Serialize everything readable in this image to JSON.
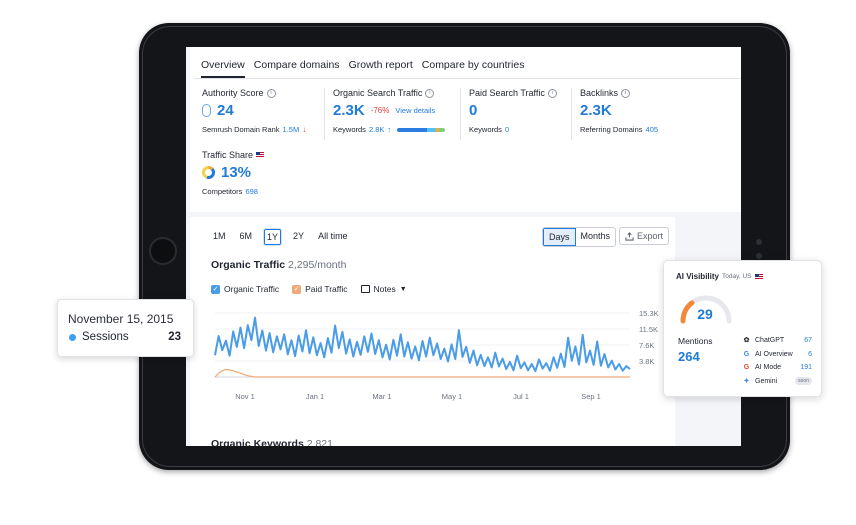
{
  "tabs": [
    "Overview",
    "Compare domains",
    "Growth report",
    "Compare by countries"
  ],
  "metrics": {
    "authority": {
      "label": "Authority Score",
      "value": "24",
      "sub_label": "Semrush Domain Rank",
      "sub_value": "1.5M",
      "sub_arrow": "↓"
    },
    "organic": {
      "label": "Organic Search Traffic",
      "value": "2.3K",
      "change": "-76%",
      "link": "View details",
      "sub_label": "Keywords",
      "sub_value": "2.8K",
      "sub_arrow": "↑"
    },
    "paid": {
      "label": "Paid Search Traffic",
      "value": "0",
      "sub_label": "Keywords",
      "sub_value": "0"
    },
    "backlinks": {
      "label": "Backlinks",
      "value": "2.3K",
      "sub_label": "Referring Domains",
      "sub_value": "405"
    },
    "traffic_share": {
      "label": "Traffic Share",
      "value": "13%",
      "sub_label": "Competitors",
      "sub_value": "698"
    }
  },
  "ranges": [
    "1M",
    "6M",
    "1Y",
    "2Y",
    "All time"
  ],
  "active_range": "1Y",
  "toggle": {
    "days": "Days",
    "months": "Months",
    "active": "Days"
  },
  "export_label": "Export",
  "chart_title": "Organic Traffic",
  "chart_subtitle": "2,295/month",
  "legend": {
    "organic": "Organic Traffic",
    "paid": "Paid Traffic",
    "notes": "Notes"
  },
  "keywords_title": "Organic Keywords",
  "keywords_value": "2,821",
  "colors": {
    "accent": "#1f7bd8",
    "organic": "#4a9ce8",
    "paid": "#f0a979",
    "negative": "#e23d3d"
  },
  "chart_data": {
    "type": "line",
    "x": [
      "Nov 1",
      "Jan 1",
      "Mar 1",
      "May 1",
      "Jul 1",
      "Sep 1"
    ],
    "ylim": [
      0,
      15300
    ],
    "yticks": [
      "15.3K",
      "11.5K",
      "7.6K",
      "3.8K",
      "0"
    ],
    "series": [
      {
        "name": "Organic Traffic",
        "values": [
          5200,
          9800,
          6400,
          8700,
          5100,
          10900,
          7200,
          11800,
          6900,
          12400,
          8800,
          14200,
          7400,
          11100,
          6300,
          10500,
          5900,
          9700,
          6600,
          10200,
          5400,
          8800,
          5000,
          9900,
          6100,
          11200,
          5700,
          9500,
          5200,
          8100,
          4700,
          9300,
          5800,
          12300,
          6900,
          10800,
          5600,
          9000,
          4900,
          8400,
          5300,
          9700,
          6000,
          10400,
          5500,
          8800,
          4700,
          7700,
          4200,
          8900,
          5100,
          10200,
          4900,
          8300,
          4400,
          7300,
          4000,
          8600,
          4900,
          9400,
          5200,
          8000,
          4300,
          6800,
          3700,
          7800,
          4300,
          11200,
          4800,
          7200,
          3400,
          6300,
          2800,
          5300,
          2600,
          4700,
          2300,
          5800,
          2500,
          4400,
          1900,
          3600,
          1600,
          5100,
          2100,
          3500,
          1600,
          3100,
          1400,
          4200,
          2000,
          3300,
          1500,
          4700,
          2200,
          5600,
          2400,
          9400,
          3900,
          7300,
          3000,
          10100,
          3500,
          6300,
          2900,
          8500,
          2700,
          5500,
          2300,
          3900,
          1800,
          3100,
          1500,
          2600,
          1900
        ]
      },
      {
        "name": "Paid Traffic",
        "values": [
          0,
          900,
          1500,
          1800,
          1700,
          1500,
          1200,
          900,
          600,
          300,
          150,
          0,
          0,
          0,
          0,
          0,
          0,
          0,
          0,
          0,
          0,
          0,
          0,
          0,
          0,
          0,
          0,
          0,
          0,
          0,
          0,
          0,
          0,
          0,
          0,
          0,
          0,
          0,
          0,
          0,
          0,
          0,
          0,
          0,
          0,
          0,
          0,
          0,
          0,
          0,
          0,
          0,
          0,
          0,
          0,
          0,
          0,
          0,
          0,
          0,
          0,
          0,
          0,
          0,
          0,
          0,
          0,
          0,
          0,
          0,
          0,
          0,
          0,
          0,
          0,
          0,
          0,
          0,
          0,
          0,
          0,
          0,
          0,
          0,
          0,
          0,
          0,
          0,
          0,
          0,
          0,
          0,
          0,
          0,
          0,
          0,
          0,
          0,
          0,
          0,
          0,
          0,
          0,
          0,
          0,
          0,
          0,
          0,
          0,
          0,
          0,
          0,
          0,
          0,
          0
        ]
      }
    ]
  },
  "tooltip": {
    "date": "November 15, 2015",
    "label": "Sessions",
    "value": "23"
  },
  "ai_visibility": {
    "title": "AI Visibility",
    "subtitle": "Today, US",
    "score": "29",
    "score_fraction": 0.29,
    "mentions_label": "Mentions",
    "mentions_value": "264",
    "sources": [
      {
        "name": "ChatGPT",
        "count": "67",
        "icon": "chatgpt-icon"
      },
      {
        "name": "AI Overview",
        "count": "6",
        "icon": "google-icon"
      },
      {
        "name": "AI Mode",
        "count": "191",
        "icon": "google-icon"
      },
      {
        "name": "Gemini",
        "count": "",
        "badge": "soon",
        "icon": "gemini-icon"
      }
    ]
  }
}
